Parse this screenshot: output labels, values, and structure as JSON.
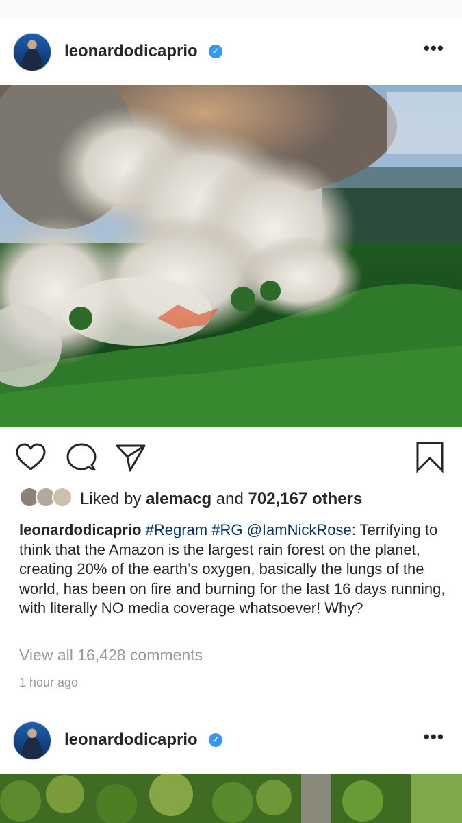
{
  "colors": {
    "accent": "#3897f0",
    "link": "#003569",
    "muted": "#999999",
    "text": "#262626"
  },
  "post1": {
    "username": "leonardodicaprio",
    "verified_icon": "verified-badge-icon",
    "more_icon": "more-options-icon",
    "more_label": "•••",
    "likes": {
      "prefix": "Liked by ",
      "user": "alemacg",
      "mid": " and ",
      "count": "702,167 others"
    },
    "caption": {
      "username": "leonardodicaprio",
      "tag1": "#Regram",
      "tag2": "#RG",
      "mention": "@IamNickRose",
      "text": ": Terrifying to think that the Amazon is the largest rain forest on the planet, creating 20% of the earth’s oxygen, basically the lungs of the world, has been on fire and burning for the last 16 days running, with literally NO media coverage whatsoever! Why?"
    },
    "comments_link": "View all 16,428 comments",
    "timestamp": "1 hour ago",
    "actions": [
      "heart-icon",
      "comment-icon",
      "share-icon",
      "bookmark-icon"
    ]
  },
  "post2": {
    "username": "leonardodicaprio",
    "more_label": "•••"
  }
}
